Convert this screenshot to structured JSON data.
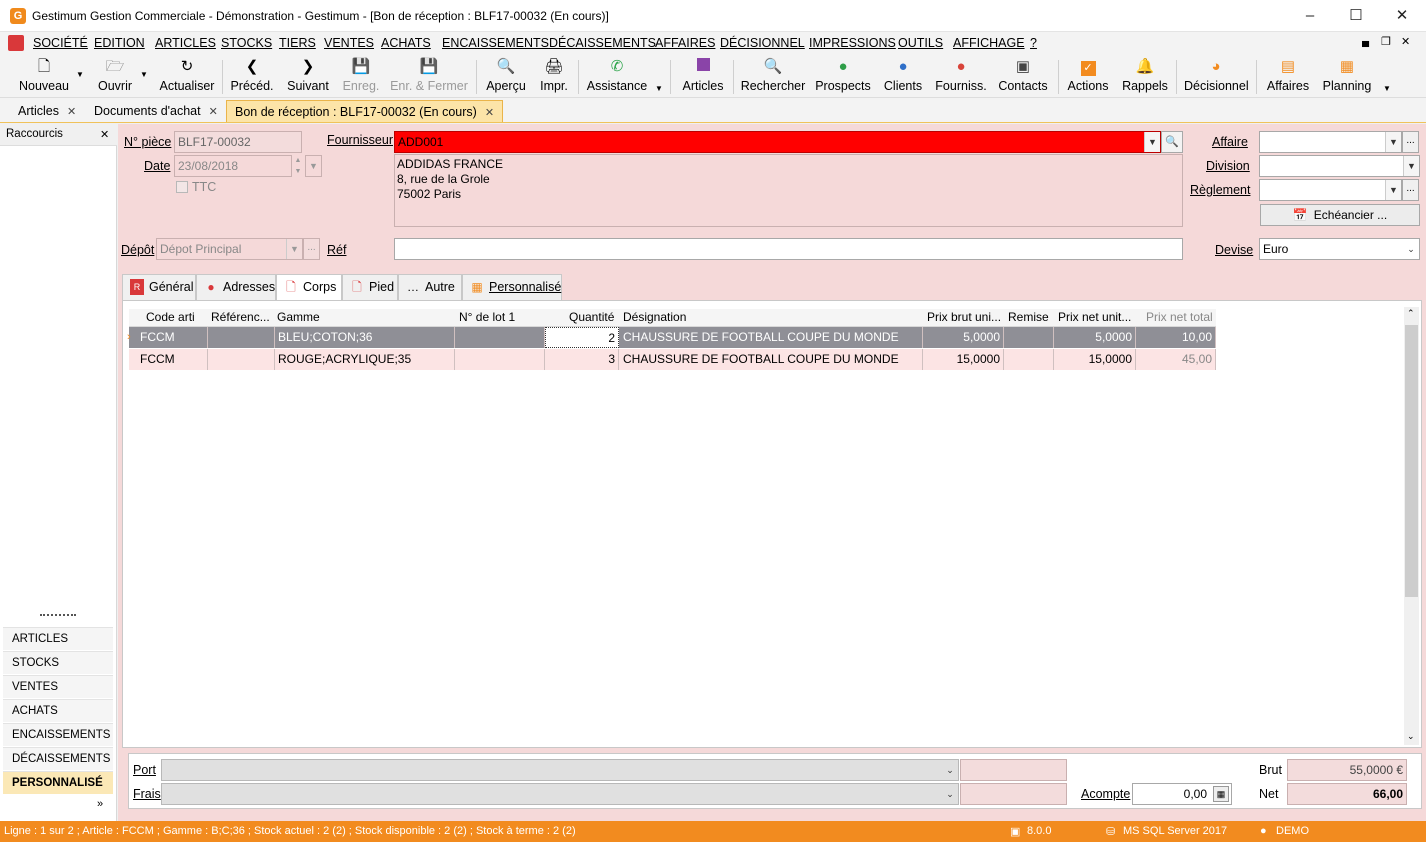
{
  "window": {
    "title": "Gestimum Gestion Commerciale - Démonstration - Gestimum - [Bon de réception : BLF17-00032 (En cours)]",
    "logo": "G"
  },
  "menu": [
    "SOCIÉTÉ",
    "EDITION",
    "ARTICLES",
    "STOCKS",
    "TIERS",
    "VENTES",
    "ACHATS",
    "ENCAISSEMENTS",
    "DÉCAISSEMENTS",
    "AFFAIRES",
    "DÉCISIONNEL",
    "IMPRESSIONS",
    "OUTILS",
    "AFFICHAGE",
    "?"
  ],
  "toolbar": {
    "nouveau": "Nouveau",
    "ouvrir": "Ouvrir",
    "actualiser": "Actualiser",
    "preced": "Précéd.",
    "suivant": "Suivant",
    "enreg": "Enreg.",
    "enr_fermer": "Enr. & Fermer",
    "apercu": "Aperçu",
    "impr": "Impr.",
    "assistance": "Assistance",
    "articles": "Articles",
    "rechercher": "Rechercher",
    "prospects": "Prospects",
    "clients": "Clients",
    "fourniss": "Fourniss.",
    "contacts": "Contacts",
    "actions": "Actions",
    "rappels": "Rappels",
    "decisionnel": "Décisionnel",
    "affaires": "Affaires",
    "planning": "Planning"
  },
  "doc_tabs": [
    "Articles",
    "Documents d'achat",
    "Bon de réception : BLF17-00032 (En cours)"
  ],
  "sidebar": {
    "title": "Raccourcis",
    "items": [
      "ARTICLES",
      "STOCKS",
      "VENTES",
      "ACHATS",
      "ENCAISSEMENTS",
      "DÉCAISSEMENTS",
      "PERSONNALISÉ"
    ]
  },
  "form": {
    "npiece_label": "N° pièce",
    "npiece": "BLF17-00032",
    "date_label": "Date",
    "date": "23/08/2018",
    "ttc_label": "TTC",
    "fournisseur_label": "Fournisseur",
    "fournisseur_code": "ADD001",
    "address": [
      "ADDIDAS FRANCE",
      "8, rue de la Grole",
      "75002 Paris"
    ],
    "affaire_label": "Affaire",
    "division_label": "Division",
    "reglement_label": "Règlement",
    "echeancier": "Echéancier ...",
    "depot_label": "Dépôt",
    "depot": "Dépot Principal",
    "ref_label": "Réf",
    "devise_label": "Devise",
    "devise": "Euro"
  },
  "tabs": [
    "Général",
    "Adresses",
    "Corps",
    "Pied",
    "Autre",
    "Personnalisé"
  ],
  "grid": {
    "headers": [
      "Code arti",
      "Référenc...",
      "Gamme",
      "N° de lot 1",
      "Quantité",
      "Désignation",
      "Prix brut uni...",
      "Remise",
      "Prix net unit...",
      "Prix net total"
    ],
    "rows": [
      [
        "FCCM",
        "",
        "BLEU;COTON;36",
        "",
        "2",
        "CHAUSSURE DE FOOTBALL COUPE DU MONDE",
        "5,0000",
        "",
        "5,0000",
        "10,00"
      ],
      [
        "FCCM",
        "",
        "ROUGE;ACRYLIQUE;35",
        "",
        "3",
        "CHAUSSURE DE FOOTBALL COUPE DU MONDE",
        "15,0000",
        "",
        "15,0000",
        "45,00"
      ]
    ]
  },
  "footer": {
    "port_label": "Port",
    "frais_label": "Frais",
    "acompte_label": "Acompte",
    "acompte": "0,00",
    "brut_label": "Brut",
    "brut": "55,0000 €",
    "net_label": "Net",
    "net": "66,00"
  },
  "status": {
    "line": "Ligne : 1 sur 2 ; Article : FCCM ; Gamme : B;C;36 ; Stock actuel : 2 (2) ; Stock disponible : 2 (2) ; Stock à terme : 2 (2)",
    "version": "8.0.0",
    "db": "MS SQL Server 2017",
    "user": "DEMO"
  },
  "colors": {
    "accent": "#f28b1f",
    "supplier_bg": "#ff0000",
    "form_bg": "#f5d9d9",
    "selected_row": "#8f8f96"
  }
}
